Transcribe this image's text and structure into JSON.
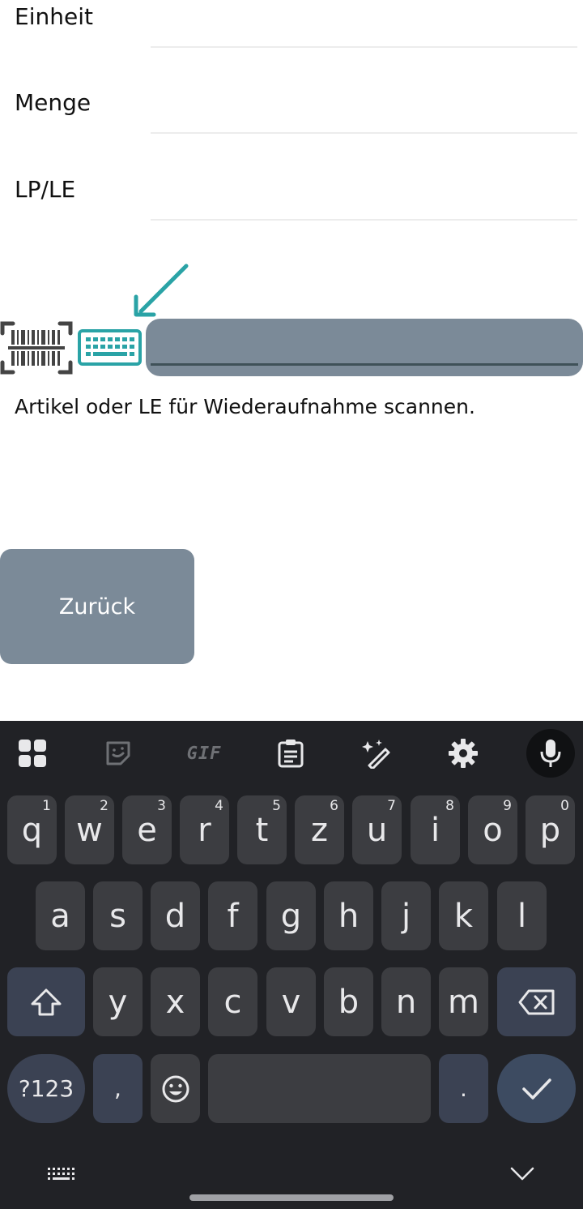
{
  "form": {
    "fields": [
      {
        "label": "Einheit"
      },
      {
        "label": "Menge"
      },
      {
        "label": "LP/LE"
      }
    ],
    "scan_input": {
      "value": "",
      "placeholder": ""
    },
    "hint": "Artikel oder LE für Wiederaufnahme scannen.",
    "back_label": "Zurück"
  },
  "colors": {
    "accent_teal": "#2aa3a6",
    "input_bg": "#7b8a98",
    "button_bg": "#7b8a98",
    "keyboard_bg": "#212226",
    "key_bg": "#3c3d41"
  },
  "keyboard": {
    "toolbar": [
      "apps-grid-icon",
      "sticker-icon",
      "GIF",
      "clipboard-icon",
      "magic-pen-icon",
      "gear-icon",
      "microphone-icon"
    ],
    "gif_label": "GIF",
    "row1": [
      {
        "label": "q",
        "num": "1"
      },
      {
        "label": "w",
        "num": "2"
      },
      {
        "label": "e",
        "num": "3"
      },
      {
        "label": "r",
        "num": "4"
      },
      {
        "label": "t",
        "num": "5"
      },
      {
        "label": "z",
        "num": "6"
      },
      {
        "label": "u",
        "num": "7"
      },
      {
        "label": "i",
        "num": "8"
      },
      {
        "label": "o",
        "num": "9"
      },
      {
        "label": "p",
        "num": "0"
      }
    ],
    "row2": [
      "a",
      "s",
      "d",
      "f",
      "g",
      "h",
      "j",
      "k",
      "l"
    ],
    "row3": [
      "y",
      "x",
      "c",
      "v",
      "b",
      "n",
      "m"
    ],
    "symbols_label": "?123",
    "comma_label": ",",
    "period_label": "."
  }
}
